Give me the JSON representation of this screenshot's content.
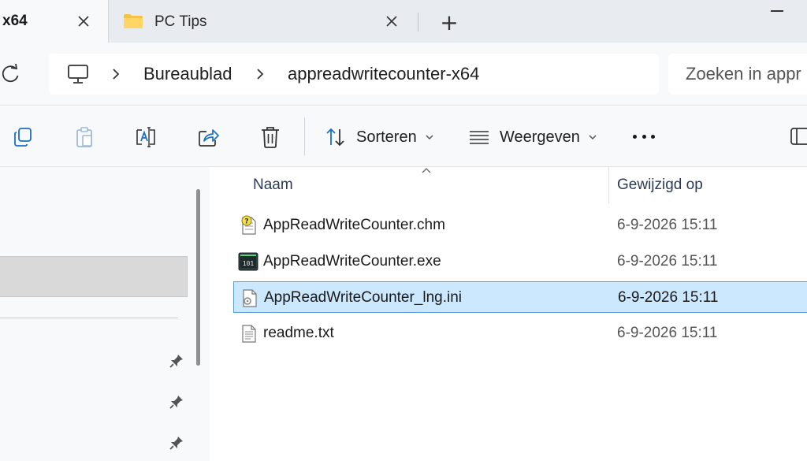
{
  "tabs": [
    {
      "title": "x64"
    },
    {
      "title": "PC Tips"
    }
  ],
  "new_tab_glyph": "+",
  "address": {
    "crumbs": [
      "Bureaublad",
      "appreadwritecounter-x64"
    ]
  },
  "search": {
    "placeholder": "Zoeken in appr"
  },
  "commands": {
    "sort_label": "Sorteren",
    "view_label": "Weergeven"
  },
  "columns": {
    "name": "Naam",
    "modified": "Gewijzigd op"
  },
  "files": [
    {
      "name": "AppReadWriteCounter.chm",
      "modified": "6-9-2026 15:11",
      "icon": "chm-help-file-icon"
    },
    {
      "name": "AppReadWriteCounter.exe",
      "modified": "6-9-2026 15:11",
      "icon": "exe-application-icon"
    },
    {
      "name": "AppReadWriteCounter_lng.ini",
      "modified": "6-9-2026 15:11",
      "icon": "ini-settings-file-icon",
      "selected": true
    },
    {
      "name": "readme.txt",
      "modified": "6-9-2026 15:11",
      "icon": "text-file-icon"
    }
  ],
  "colors": {
    "selection_fill": "#cce8ff",
    "selection_border": "#5a9bd4",
    "folder_yellow": "#f6c343",
    "accent_blue": "#1e6fc4"
  }
}
